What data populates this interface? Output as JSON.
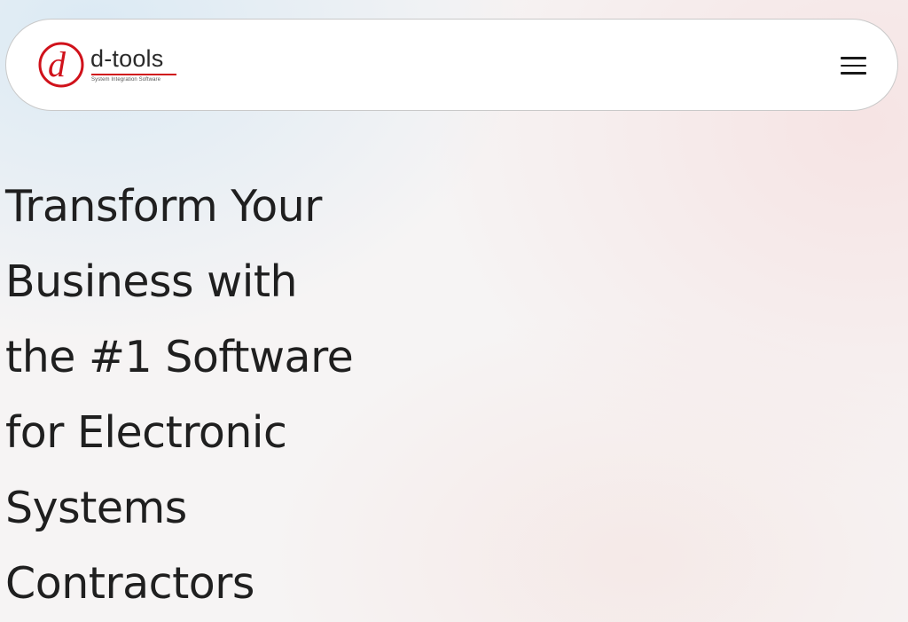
{
  "header": {
    "logo": {
      "wordmark": "d-tools",
      "tagline": "System Integration Software",
      "brand_color": "#d0121b"
    },
    "menu_icon": "hamburger-menu-icon"
  },
  "hero": {
    "title_lines": [
      "Transform Your",
      "Business with",
      "the #1 Software",
      "for Electronic",
      "Systems",
      "Contractors"
    ]
  }
}
